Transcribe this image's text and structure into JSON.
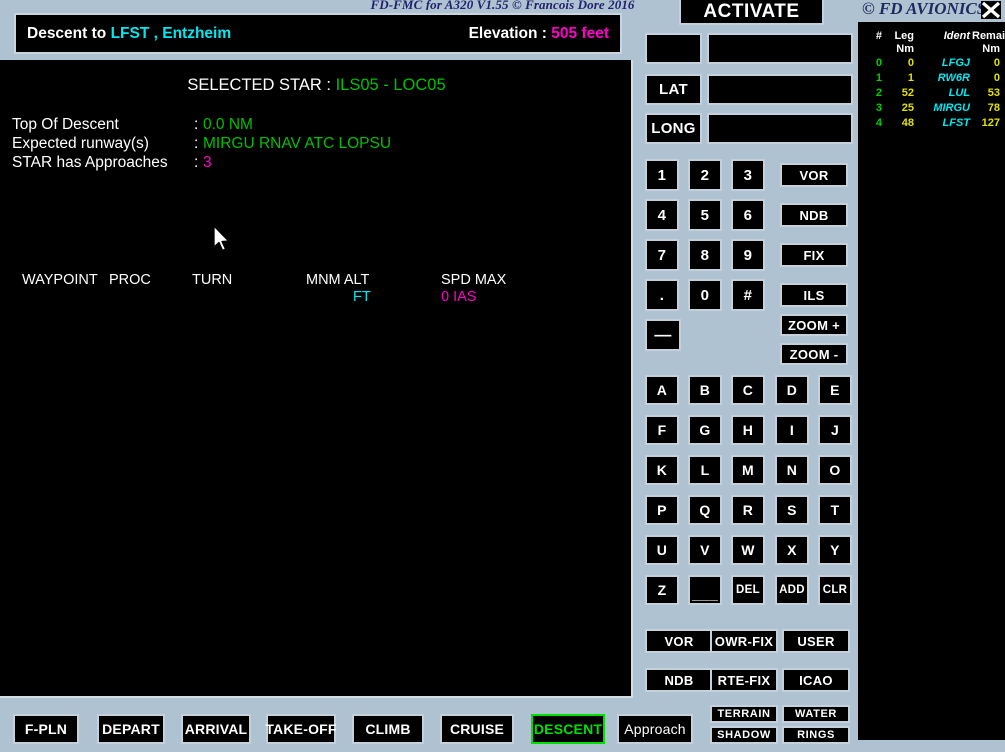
{
  "app": {
    "title": "FD-FMC for A320 V1.55 © Francois Dore 2016",
    "brand": "© FD AVIONICS",
    "close_icon": "close-x-icon"
  },
  "banner": {
    "prefix": "Descent to ",
    "destination": "LFST , Entzheim",
    "elevation_label": "Elevation : ",
    "elevation_value": "505 feet"
  },
  "display": {
    "selected_star_label": "SELECTED STAR : ",
    "selected_star_value": "ILS05 - LOC05",
    "info": [
      {
        "key": "Top Of Descent",
        "sep": ":",
        "value": "0.0 NM",
        "color": "green"
      },
      {
        "key": "Expected runway(s)",
        "sep": ":",
        "value": "MIRGU RNAV ATC LOPSU",
        "color": "green"
      },
      {
        "key": "STAR has Approaches",
        "sep": ":",
        "value": "3",
        "color": "mag"
      }
    ],
    "columns": {
      "waypoint": "WAYPOINT",
      "proc": "PROC",
      "turn": "TURN",
      "mnm_alt": "MNM ALT",
      "mnm_alt_unit": "FT",
      "spd_max": "SPD MAX",
      "spd_max_unit": "0 IAS"
    },
    "rows": []
  },
  "keypad": {
    "activate": "ACTIVATE",
    "lat_label": "LAT",
    "long_label": "LONG",
    "blank_field_value": "",
    "lat_value": "",
    "long_value": "",
    "numbers": [
      "1",
      "2",
      "3",
      "4",
      "5",
      "6",
      "7",
      "8",
      "9",
      ".",
      "0",
      "#"
    ],
    "minus": "—",
    "navaids": [
      "VOR",
      "NDB",
      "FIX",
      "ILS",
      "ZOOM +",
      "ZOOM -"
    ],
    "letters": [
      "A",
      "B",
      "C",
      "D",
      "E",
      "F",
      "G",
      "H",
      "I",
      "J",
      "K",
      "L",
      "M",
      "N",
      "O",
      "P",
      "Q",
      "R",
      "S",
      "T",
      "U",
      "V",
      "W",
      "X",
      "Y",
      "Z"
    ],
    "space": "___",
    "edit_keys": [
      "DEL",
      "ADD",
      "CLR"
    ],
    "functions": [
      "VOR",
      "OWR-FIX",
      "USER",
      "NDB",
      "RTE-FIX",
      "ICAO"
    ],
    "toggles": [
      "TERRAIN",
      "WATER",
      "SHADOW",
      "RINGS"
    ]
  },
  "navbar": {
    "items": [
      {
        "label": "F-PLN",
        "active": false,
        "plain": false
      },
      {
        "label": "DEPART",
        "active": false,
        "plain": false
      },
      {
        "label": "ARRIVAL",
        "active": false,
        "plain": false
      },
      {
        "label": "TAKE-OFF",
        "active": false,
        "plain": false
      },
      {
        "label": "CLIMB",
        "active": false,
        "plain": false
      },
      {
        "label": "CRUISE",
        "active": false,
        "plain": false
      },
      {
        "label": "DESCENT",
        "active": true,
        "plain": false
      },
      {
        "label": "Approach",
        "active": false,
        "plain": true
      }
    ]
  },
  "flightplan": {
    "headers": {
      "num": "#",
      "leg": "Leg",
      "leg_unit": "Nm",
      "ident": "Ident",
      "remain": "Remain",
      "remain_unit": "Nm"
    },
    "rows": [
      {
        "num": "0",
        "leg": "0",
        "ident": "LFGJ",
        "remain": "0"
      },
      {
        "num": "1",
        "leg": "1",
        "ident": "RW6R",
        "remain": "0"
      },
      {
        "num": "2",
        "leg": "52",
        "ident": "LUL",
        "remain": "53"
      },
      {
        "num": "3",
        "leg": "25",
        "ident": "MIRGU",
        "remain": "78"
      },
      {
        "num": "4",
        "leg": "48",
        "ident": "LFST",
        "remain": "127"
      }
    ]
  },
  "colors": {
    "background": "#afc2d1",
    "screen": "#000000",
    "accent_green": "#00c000",
    "accent_cyan": "#00e8f0",
    "accent_magenta": "#ff00c8",
    "accent_yellow": "#e0e000",
    "title_navy": "#21226e"
  }
}
